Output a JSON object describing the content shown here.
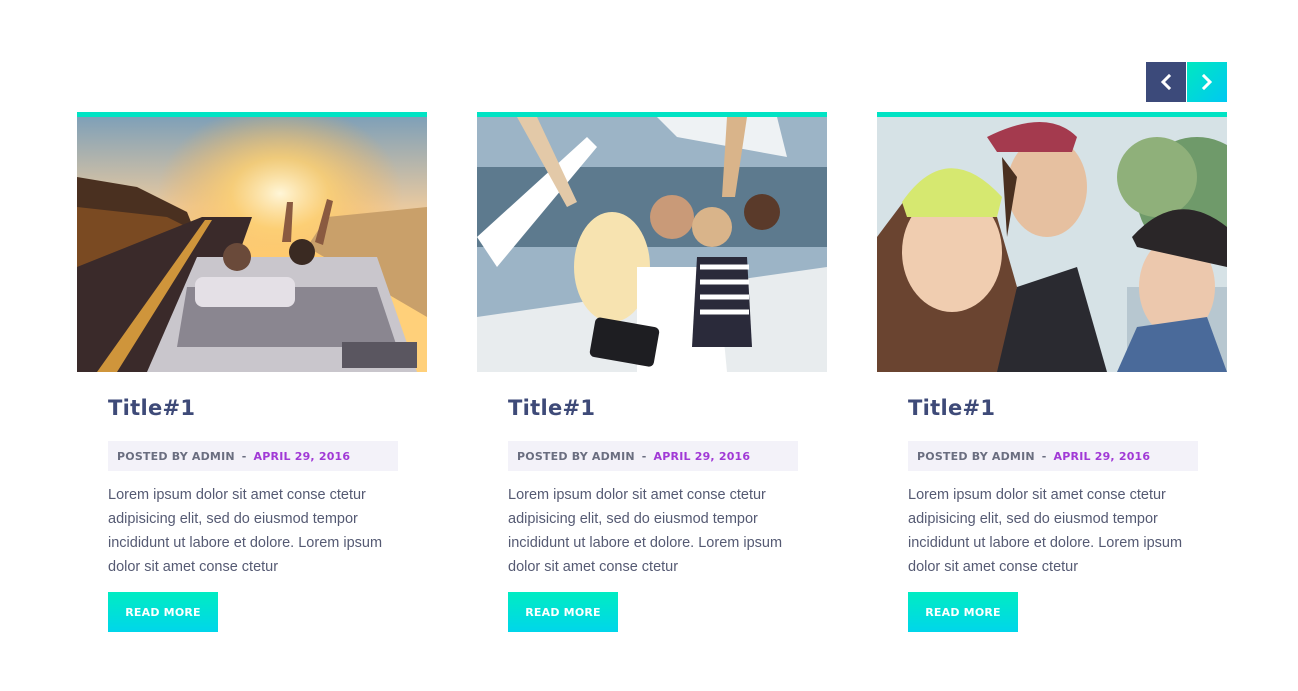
{
  "carousel": {
    "prev_icon": "chevron-left-icon",
    "next_icon": "chevron-right-icon",
    "prev_color": "#3c4a7a",
    "next_color": "#00e3d0"
  },
  "accent_color": "#00e3c4",
  "title_color": "#3e4a78",
  "date_color": "#a13ad6",
  "posts": [
    {
      "image": "convertible-sunset-photo",
      "title": "Title#1",
      "author": "POSTED BY ADMIN",
      "separator": "-",
      "date": "APRIL 29, 2016",
      "excerpt": "Lorem ipsum dolor sit amet conse ctetur adipisicing elit, sed do eiusmod tempor incididunt ut labore et dolore. Lorem ipsum dolor sit amet conse ctetur",
      "button": "READ MORE"
    },
    {
      "image": "boat-selfie-photo",
      "title": "Title#1",
      "author": "POSTED BY ADMIN",
      "separator": "-",
      "date": "APRIL 29, 2016",
      "excerpt": "Lorem ipsum dolor sit amet conse ctetur adipisicing elit, sed do eiusmod tempor incididunt ut labore et dolore. Lorem ipsum dolor sit amet conse ctetur",
      "button": "READ MORE"
    },
    {
      "image": "friends-smiling-photo",
      "title": "Title#1",
      "author": "POSTED BY ADMIN",
      "separator": "-",
      "date": "APRIL 29, 2016",
      "excerpt": "Lorem ipsum dolor sit amet conse ctetur adipisicing elit, sed do eiusmod tempor incididunt ut labore et dolore. Lorem ipsum dolor sit amet conse ctetur",
      "button": "READ MORE"
    }
  ]
}
